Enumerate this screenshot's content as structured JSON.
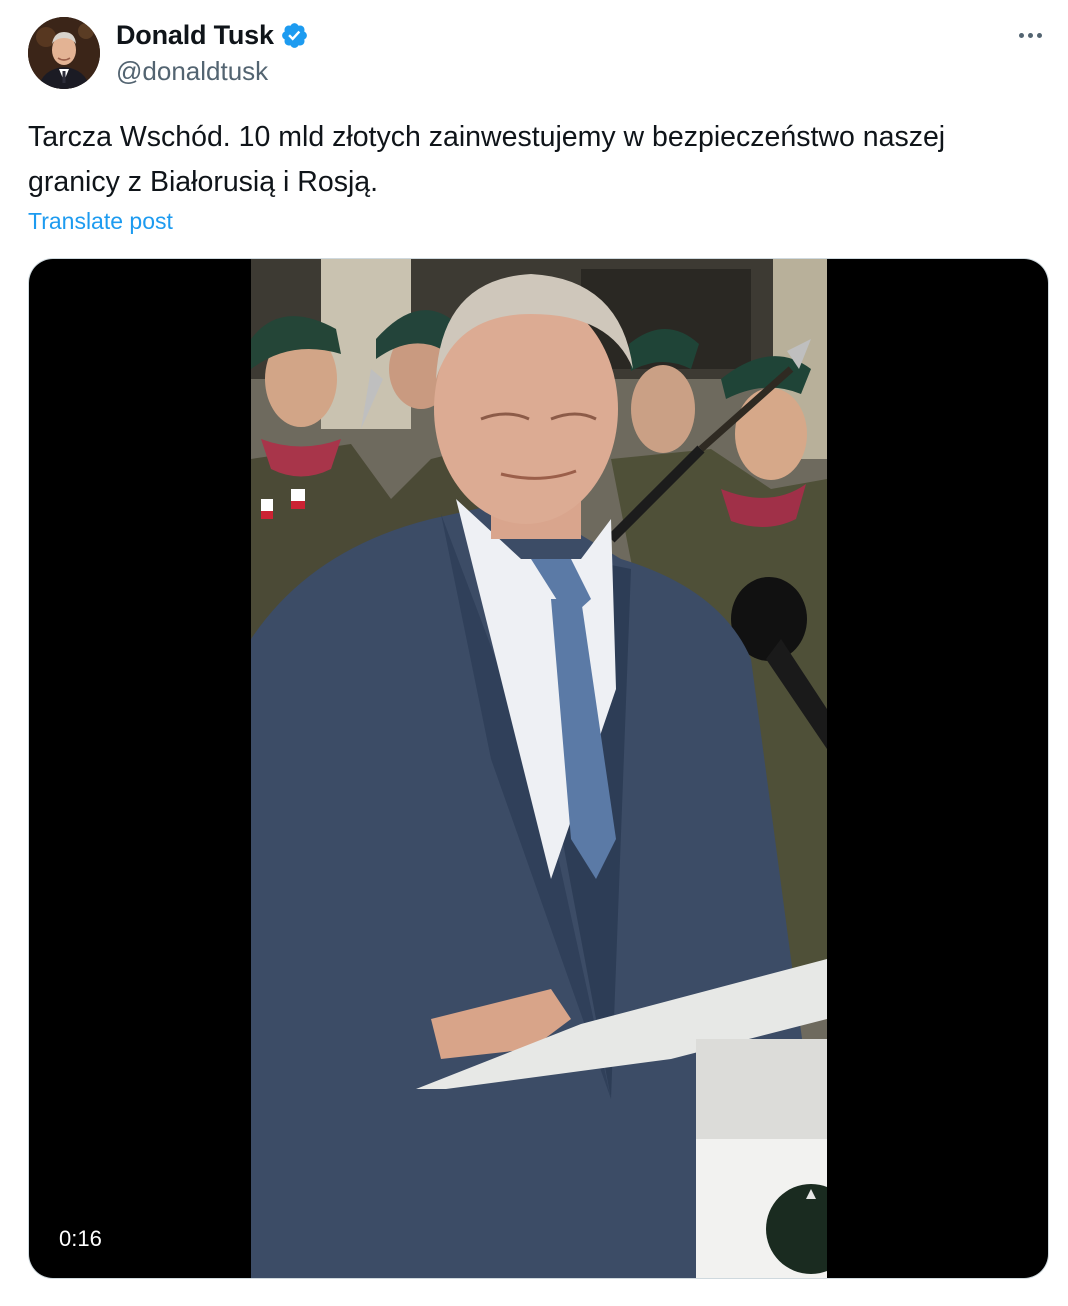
{
  "author": {
    "display_name": "Donald Tusk",
    "handle": "@donaldtusk",
    "verified_icon": "verified-badge-icon",
    "avatar_icon": "profile-avatar"
  },
  "post": {
    "text": "Tarcza Wschód. 10 mld złotych zainwestujemy w bezpieczeństwo naszej\ngranicy z Białorusią i Rosją.",
    "translate_label": "Translate post"
  },
  "media": {
    "duration": "0:16"
  },
  "colors": {
    "link": "#1d9bf0",
    "verified": "#1d9bf0",
    "secondary_text": "#536471",
    "primary_text": "#0f1419"
  }
}
